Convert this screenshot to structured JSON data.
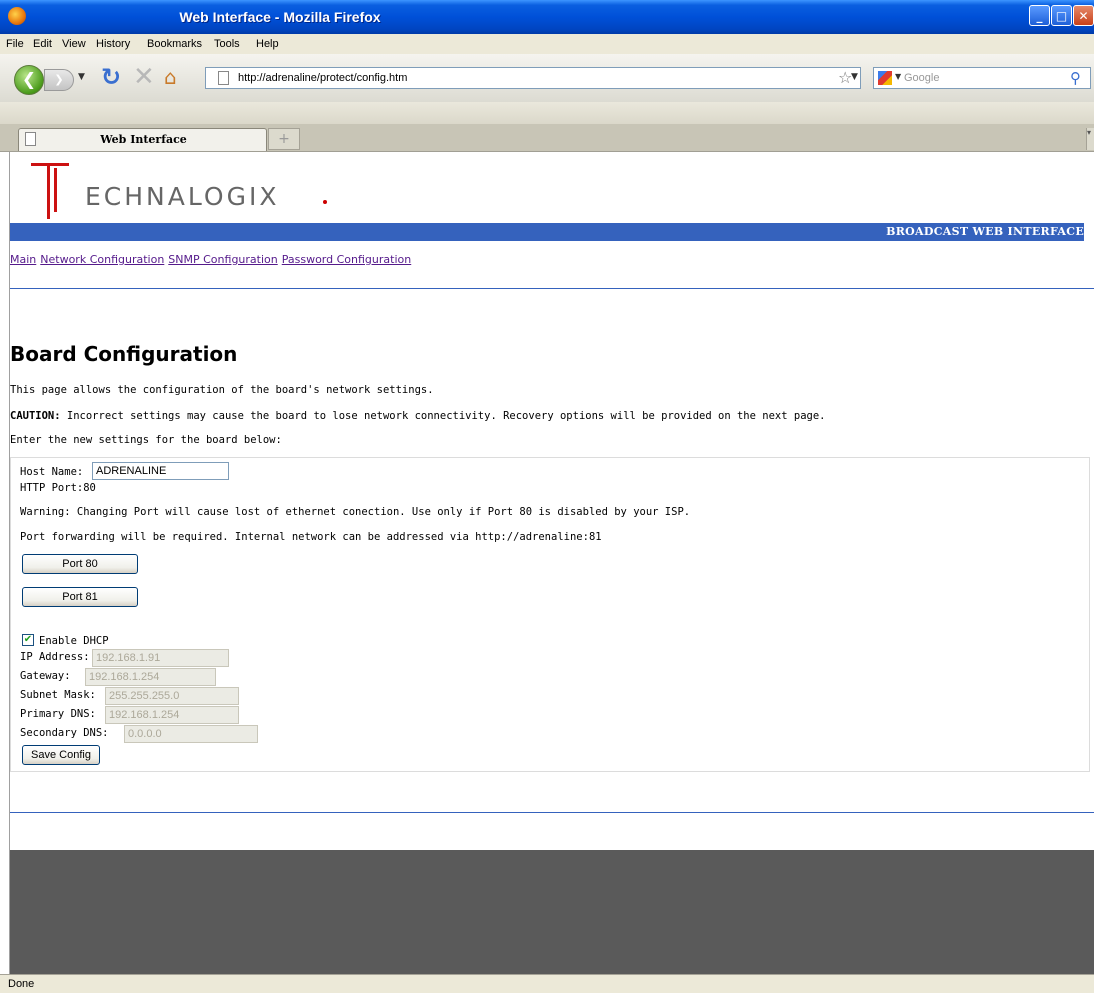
{
  "window": {
    "title": "Web Interface - Mozilla Firefox",
    "controls": {
      "minimize": "_",
      "maximize": "□",
      "close": "✕"
    }
  },
  "menu": {
    "items": [
      "File",
      "Edit",
      "View",
      "History",
      "Bookmarks",
      "Tools",
      "Help"
    ]
  },
  "toolbar": {
    "url": "http://adrenaline/protect/config.htm",
    "search_placeholder": "Google",
    "icons": [
      "back-icon",
      "forward-icon",
      "reload-icon",
      "stop-icon",
      "home-icon",
      "star-icon",
      "search-icon"
    ]
  },
  "tabs": {
    "active_label": "Web Interface",
    "new_tab_symbol": "+"
  },
  "page": {
    "logo_text": "ECHNALOGIX",
    "banner": "BROADCAST WEB INTERFACE",
    "nav_links": [
      "Main",
      "Network Configuration",
      "SNMP Configuration",
      "Password Configuration"
    ],
    "heading": "Board Configuration",
    "intro": "This page allows the configuration of the board's network settings.",
    "caution_label": "CAUTION:",
    "caution_text": " Incorrect settings may cause the board to lose network connectivity. Recovery options will be provided on the next page.",
    "enter_text": "Enter the new settings for the board below:",
    "form": {
      "host_label": "Host Name:",
      "host_value": "ADRENALINE",
      "http_port": "HTTP Port:80",
      "warning": "Warning: Changing Port will cause lost of ethernet conection. Use only if Port 80 is disabled by your ISP.",
      "forwarding": "Port forwarding will be required. Internal network can be addressed via http://adrenaline:81",
      "port80_label": "Port 80",
      "port81_label": "Port 81",
      "dhcp_label": "Enable DHCP",
      "dhcp_checked": true,
      "ip_label": "IP Address:",
      "ip_value": "192.168.1.91",
      "gateway_label": "Gateway:",
      "gateway_value": "192.168.1.254",
      "subnet_label": "Subnet Mask:",
      "subnet_value": "255.255.255.0",
      "pdns_label": "Primary DNS:",
      "pdns_value": "192.168.1.254",
      "sdns_label": "Secondary DNS:",
      "sdns_value": "0.0.0.0",
      "save_label": "Save Config"
    }
  },
  "status": {
    "text": "Done"
  },
  "colors": {
    "banner_blue": "#3562bd",
    "link_visited": "#551a8b",
    "logo_red": "#cc1111",
    "footer_gray": "#5a5a5a"
  }
}
